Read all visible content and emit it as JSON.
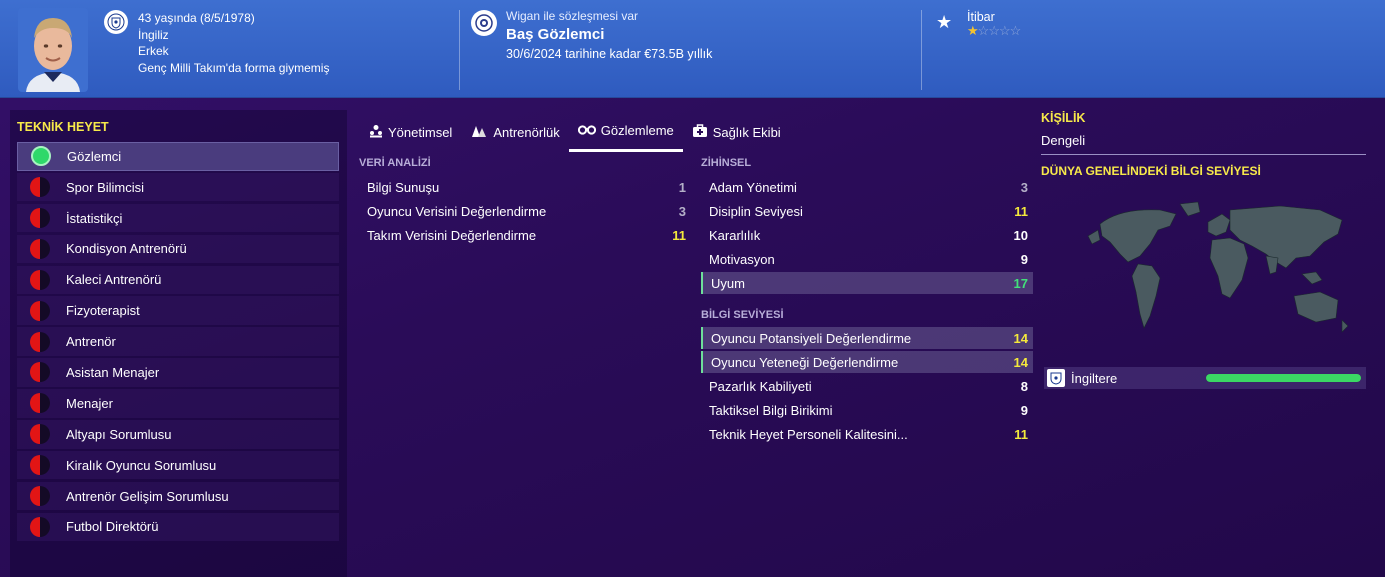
{
  "header": {
    "age_line": "43 yaşında (8/5/1978)",
    "nationality": "İngiliz",
    "gender": "Erkek",
    "intl": "Genç Milli Takım'da forma giymemiş",
    "contract_status": "Wigan ile sözleşmesi var",
    "role": "Baş Gözlemci",
    "contract_detail": "30/6/2024 tarihine kadar €73.5B yıllık",
    "reputation_label": "İtibar",
    "reputation_stars": 1,
    "reputation_max": 5
  },
  "staff": {
    "title": "TEKNİK HEYET",
    "items": [
      {
        "label": "Gözlemci",
        "active": true
      },
      {
        "label": "Spor Bilimcisi",
        "active": false
      },
      {
        "label": "İstatistikçi",
        "active": false
      },
      {
        "label": "Kondisyon Antrenörü",
        "active": false
      },
      {
        "label": "Kaleci Antrenörü",
        "active": false
      },
      {
        "label": "Fizyoterapist",
        "active": false
      },
      {
        "label": "Antrenör",
        "active": false
      },
      {
        "label": "Asistan Menajer",
        "active": false
      },
      {
        "label": "Menajer",
        "active": false
      },
      {
        "label": "Altyapı Sorumlusu",
        "active": false
      },
      {
        "label": "Kiralık Oyuncu Sorumlusu",
        "active": false
      },
      {
        "label": "Antrenör Gelişim Sorumlusu",
        "active": false
      },
      {
        "label": "Futbol Direktörü",
        "active": false
      }
    ]
  },
  "tabs": [
    {
      "label": "Yönetimsel",
      "icon": "people-icon"
    },
    {
      "label": "Antrenörlük",
      "icon": "cone-icon"
    },
    {
      "label": "Gözlemleme",
      "icon": "binoculars-icon"
    },
    {
      "label": "Sağlık Ekibi",
      "icon": "medical-kit-icon"
    }
  ],
  "data_analysis": {
    "title": "VERİ ANALİZİ",
    "rows": [
      {
        "label": "Bilgi Sunuşu",
        "value": "1"
      },
      {
        "label": "Oyuncu Verisini Değerlendirme",
        "value": "3"
      },
      {
        "label": "Takım Verisini Değerlendirme",
        "value": "11"
      }
    ]
  },
  "mental": {
    "title": "ZİHİNSEL",
    "rows": [
      {
        "label": "Adam Yönetimi",
        "value": "3"
      },
      {
        "label": "Disiplin Seviyesi",
        "value": "11"
      },
      {
        "label": "Kararlılık",
        "value": "10"
      },
      {
        "label": "Motivasyon",
        "value": "9"
      },
      {
        "label": "Uyum",
        "value": "17"
      }
    ]
  },
  "knowledge": {
    "title": "BİLGİ SEVİYESİ",
    "rows": [
      {
        "label": "Oyuncu Potansiyeli Değerlendirme",
        "value": "14"
      },
      {
        "label": "Oyuncu Yeteneği Değerlendirme",
        "value": "14"
      },
      {
        "label": "Pazarlık Kabiliyeti",
        "value": "8"
      },
      {
        "label": "Taktiksel Bilgi Birikimi",
        "value": "9"
      },
      {
        "label": "Teknik Heyet Personeli Kalitesini...",
        "value": "11"
      }
    ]
  },
  "personality": {
    "title": "KİŞİLİK",
    "value": "Dengeli"
  },
  "world_knowledge": {
    "title": "DÜNYA GENELİNDEKİ BİLGİ SEVİYESİ",
    "country": "İngiltere",
    "level": 1.0
  },
  "colors": {
    "accent_yellow": "#f7e94a",
    "header_blue": "#3e6fd0",
    "bar_green": "#3bd864"
  }
}
